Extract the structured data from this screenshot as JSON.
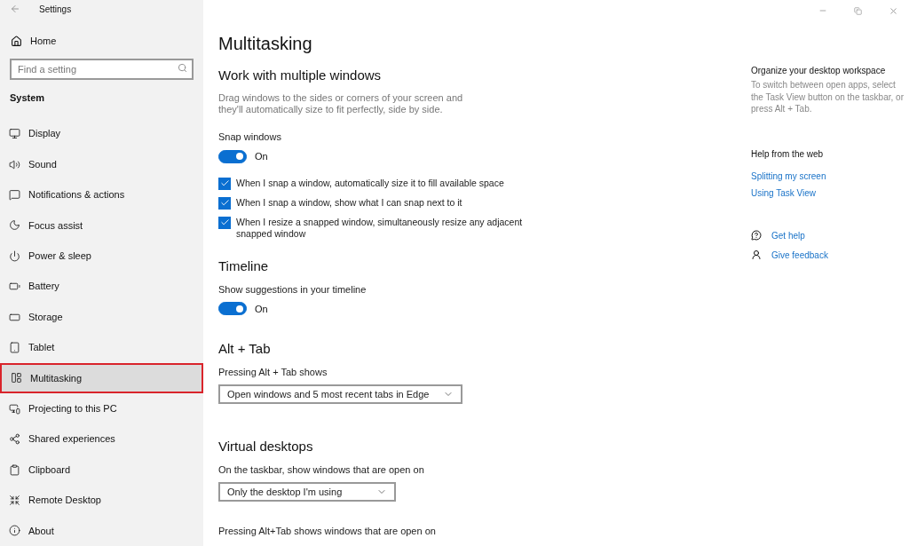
{
  "window": {
    "title": "Settings"
  },
  "sidebar": {
    "home": "Home",
    "search": {
      "placeholder": "Find a setting"
    },
    "section": "System",
    "items": [
      {
        "label": "Display",
        "selected": false
      },
      {
        "label": "Sound",
        "selected": false
      },
      {
        "label": "Notifications & actions",
        "selected": false
      },
      {
        "label": "Focus assist",
        "selected": false
      },
      {
        "label": "Power & sleep",
        "selected": false
      },
      {
        "label": "Battery",
        "selected": false
      },
      {
        "label": "Storage",
        "selected": false
      },
      {
        "label": "Tablet",
        "selected": false
      },
      {
        "label": "Multitasking",
        "selected": true
      },
      {
        "label": "Projecting to this PC",
        "selected": false
      },
      {
        "label": "Shared experiences",
        "selected": false
      },
      {
        "label": "Clipboard",
        "selected": false
      },
      {
        "label": "Remote Desktop",
        "selected": false
      },
      {
        "label": "About",
        "selected": false
      }
    ]
  },
  "main": {
    "title": "Multitasking",
    "sections": [
      {
        "heading": "Work with multiple windows",
        "items": [
          {
            "kind": "paragraph",
            "text": "Drag windows to the sides or corners of your screen and they'll automatically size to fit perfectly, side by side."
          },
          {
            "kind": "label",
            "text": "Snap windows"
          },
          {
            "kind": "toggle",
            "on": true,
            "text": "On"
          },
          {
            "kind": "checkbox",
            "checked": true,
            "text": "When I snap a window, automatically size it to fill available space"
          },
          {
            "kind": "checkbox",
            "checked": true,
            "text": "When I snap a window, show what I can snap next to it"
          },
          {
            "kind": "checkbox",
            "checked": true,
            "text": "When I resize a snapped window, simultaneously resize any adjacent snapped window"
          }
        ]
      },
      {
        "heading": "Timeline",
        "items": [
          {
            "kind": "label",
            "text": "Show suggestions in your timeline"
          },
          {
            "kind": "toggle",
            "on": true,
            "text": "On"
          }
        ]
      },
      {
        "heading": "Alt + Tab",
        "items": [
          {
            "kind": "label",
            "text": "Pressing Alt + Tab shows"
          },
          {
            "kind": "dropdown",
            "value": "Open windows and 5 most recent tabs in Edge"
          }
        ]
      },
      {
        "heading": "Virtual desktops",
        "items": [
          {
            "kind": "label",
            "text": "On the taskbar, show windows that are open on"
          },
          {
            "kind": "dropdown",
            "value": "Only the desktop I'm using"
          },
          {
            "kind": "label",
            "text": "Pressing Alt+Tab shows windows that are open on"
          }
        ]
      }
    ]
  },
  "aside": {
    "workspace": {
      "heading": "Organize your desktop workspace",
      "text": "To switch between open apps, select the Task View button on the taskbar, or press Alt + Tab."
    },
    "help": {
      "heading": "Help from the web",
      "links": [
        "Splitting my screen",
        "Using Task View"
      ]
    },
    "actions": [
      "Get help",
      "Give feedback"
    ]
  }
}
